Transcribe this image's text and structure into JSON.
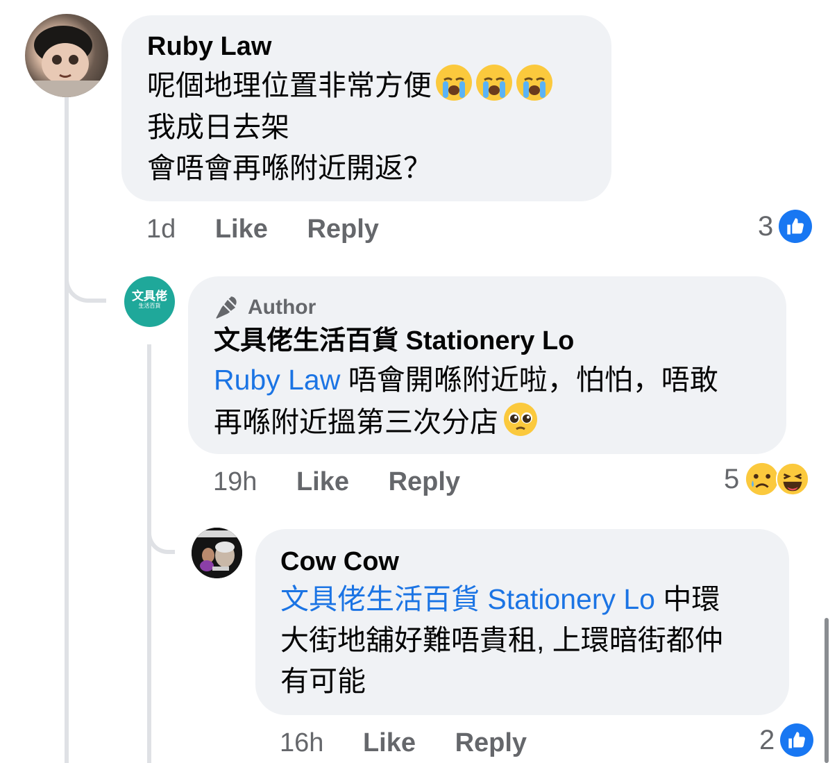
{
  "colors": {
    "bubble": "#f0f2f5",
    "mention": "#1b74e4",
    "like_blue": "#1877f2",
    "meta_gray": "#65676b",
    "thread_line": "#dfe1e5",
    "page_logo": "#1fa89a"
  },
  "comments": [
    {
      "author": "Ruby Law",
      "lines": [
        "呢個地理位置非常方便",
        "我成日去架",
        "會唔會再喺附近開返？"
      ],
      "emojis": [
        "crying-face-icon",
        "crying-face-icon",
        "crying-face-icon"
      ],
      "time": "1d",
      "like": "Like",
      "reply": "Reply",
      "reaction_count": "3",
      "reactions": [
        "like-icon"
      ]
    },
    {
      "badge": "Author",
      "badge_icon": "microphone-icon",
      "author": "文具佬生活百貨 Stationery Lo",
      "mention": "Ruby Law",
      "line1_rest": " 唔會開喺附近啦，怕怕，唔敢",
      "line2": "再喺附近搵第三次分店",
      "emoji": "pleading-face-icon",
      "avatar_text": "文具佬",
      "avatar_subtext": "生活百貨",
      "time": "19h",
      "like": "Like",
      "reply": "Reply",
      "reaction_count": "5",
      "reactions": [
        "sad-icon",
        "haha-icon"
      ]
    },
    {
      "author": "Cow Cow",
      "mention": "文具佬生活百貨 Stationery Lo",
      "line1_rest": " 中環",
      "line2": "大街地舖好難唔貴租, 上環暗街都仲",
      "line3": "有可能",
      "time": "16h",
      "like": "Like",
      "reply": "Reply",
      "reaction_count": "2",
      "reactions": [
        "like-icon"
      ]
    }
  ]
}
